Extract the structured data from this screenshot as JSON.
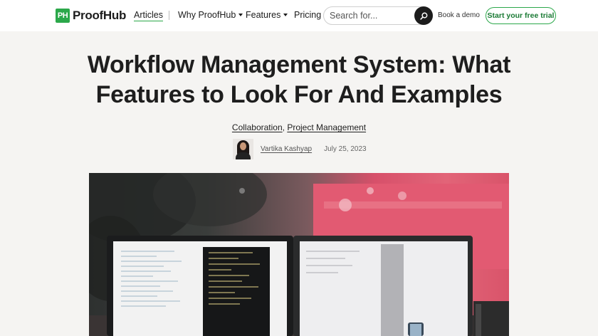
{
  "header": {
    "logo_mark": "PH",
    "logo_text": "ProofHub",
    "nav": {
      "articles": "Articles",
      "why": "Why ProofHub",
      "features": "Features",
      "pricing": "Pricing"
    },
    "search_placeholder": "Search for...",
    "book_demo": "Book a demo",
    "trial_button": "Start your free trial"
  },
  "article": {
    "title": "Workflow Management System: What Features to Look For And Examples",
    "categories": [
      "Collaboration",
      "Project Management"
    ],
    "category_separator": ",",
    "author": "Vartika Kashyap",
    "date": "July 25, 2023"
  },
  "colors": {
    "brand_green": "#2ba84a",
    "dark": "#1c1c1c",
    "page_bg": "#f5f4f2"
  },
  "icons": {
    "search": "search-icon",
    "caret": "chevron-down-icon"
  }
}
